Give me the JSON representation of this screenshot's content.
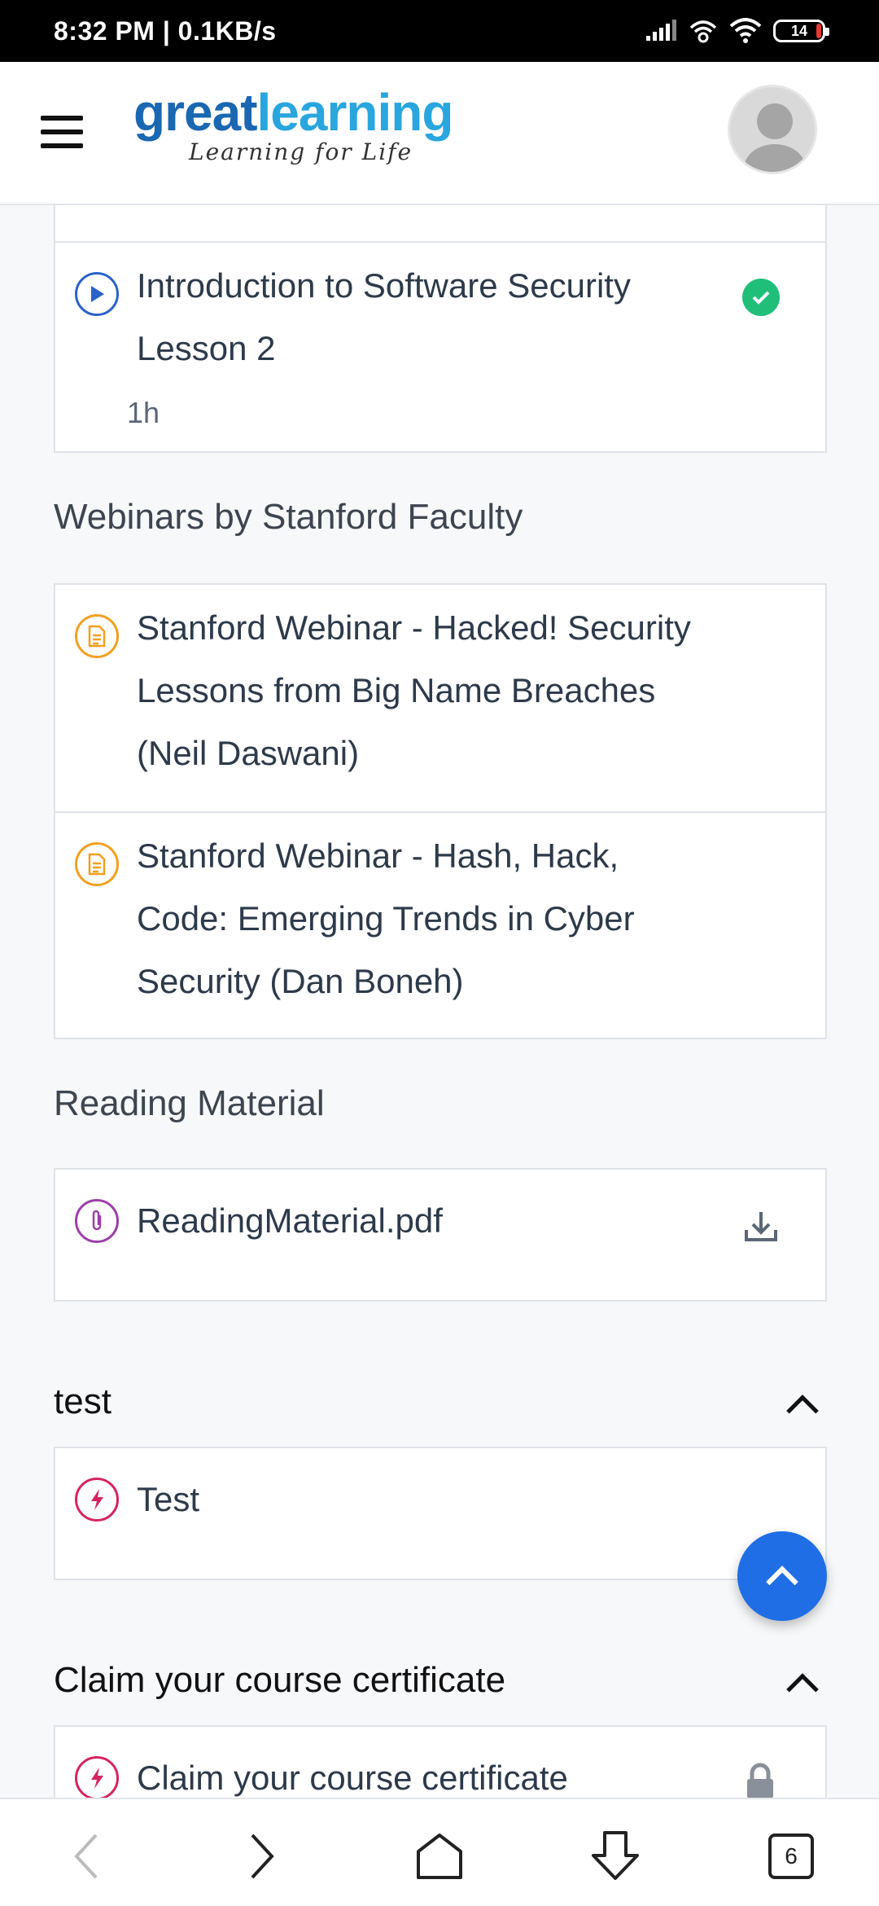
{
  "status_bar": {
    "time": "8:32 PM | 0.1KB/s",
    "battery": "14"
  },
  "header": {
    "logo_part1": "great",
    "logo_part2": "learning",
    "tagline": "Learning for Life",
    "colors": {
      "logo_dark": "#1a67b2",
      "logo_light": "#29a6de"
    }
  },
  "lessons": {
    "partial_meta": "1h",
    "items": [
      {
        "title_line1": "Introduction to Software Security",
        "title_line2": "Lesson 2",
        "duration": "1h",
        "status": "completed",
        "icon": "play-circle-icon"
      }
    ]
  },
  "webinars": {
    "heading": "Webinars by Stanford Faculty",
    "items": [
      {
        "line1": "Stanford Webinar - Hacked! Security",
        "line2": "Lessons from Big Name Breaches",
        "line3": "(Neil Daswani)",
        "icon": "document-icon"
      },
      {
        "line1": "Stanford Webinar - Hash, Hack,",
        "line2": "Code: Emerging Trends in Cyber",
        "line3": "Security (Dan Boneh)",
        "icon": "document-icon"
      }
    ]
  },
  "reading": {
    "heading": "Reading Material",
    "items": [
      {
        "title": "ReadingMaterial.pdf",
        "icon": "paperclip-icon",
        "action": "download-icon"
      }
    ]
  },
  "groups": [
    {
      "title": "test",
      "items": [
        {
          "title": "Test",
          "icon": "lightning-icon"
        }
      ]
    },
    {
      "title": "Claim your course certificate",
      "items": [
        {
          "title": "Claim your course certificate",
          "icon": "lightning-icon",
          "locked": true
        }
      ]
    }
  ],
  "browser_nav": {
    "tabs_count": "6"
  },
  "accent_colors": {
    "play": "#2a62c8",
    "check": "#1fbf7a",
    "document": "#f2a01f",
    "paperclip": "#9b3ea8",
    "lightning": "#d6245e",
    "fab": "#1f6ee6"
  }
}
